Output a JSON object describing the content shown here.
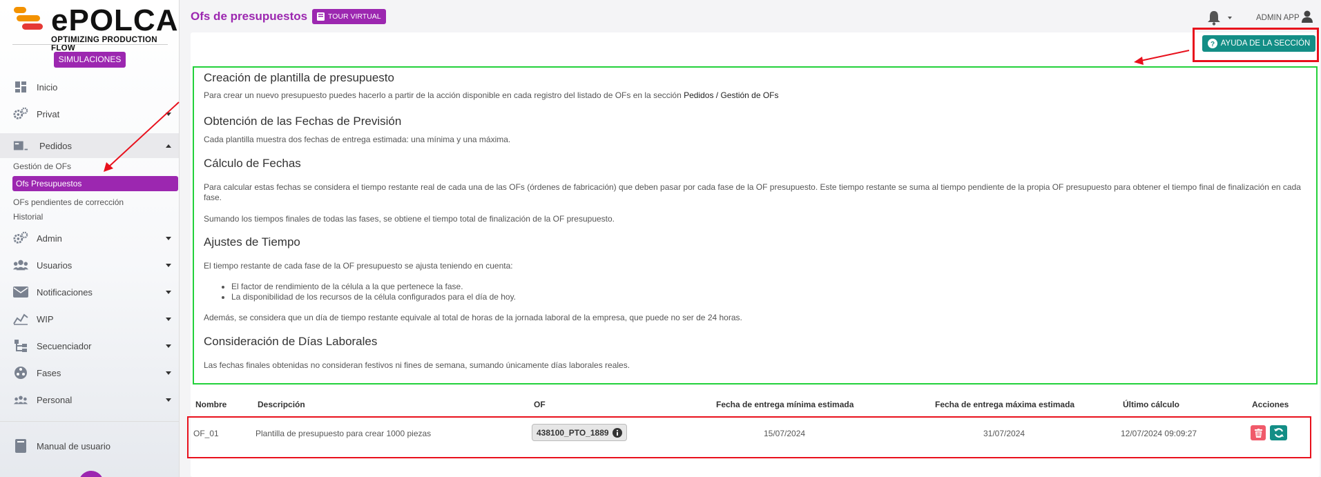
{
  "brand": {
    "name": "ePOLCA",
    "tagline": "OPTIMIZING PRODUCTION FLOW",
    "colors": {
      "orange": "#f39200",
      "red": "#e53935",
      "purple": "#9c27b0",
      "teal": "#138e86"
    }
  },
  "sidebar": {
    "simulaciones": "SIMULACIONES",
    "items": [
      {
        "label": "Inicio",
        "icon": "dashboard-icon"
      },
      {
        "label": "Privat",
        "icon": "cogs-icon"
      },
      {
        "label": "Pedidos",
        "icon": "orders-icon"
      },
      {
        "label": "Admin",
        "icon": "cogs-icon"
      },
      {
        "label": "Usuarios",
        "icon": "users-icon"
      },
      {
        "label": "Notificaciones",
        "icon": "envelope-icon"
      },
      {
        "label": "WIP",
        "icon": "chart-icon"
      },
      {
        "label": "Secuenciador",
        "icon": "sitemap-icon"
      },
      {
        "label": "Fases",
        "icon": "fases-icon"
      },
      {
        "label": "Personal",
        "icon": "personal-icon"
      }
    ],
    "pedidos_sub": [
      "Gestión de OFs",
      "Ofs Presupuestos",
      "OFs pendientes de corrección",
      "Historial"
    ],
    "manual": "Manual de usuario"
  },
  "header": {
    "title": "Ofs de presupuestos",
    "tour": "TOUR VIRTUAL",
    "user": "ADMIN APP"
  },
  "help_button": "AYUDA DE LA SECCIÓN",
  "help": {
    "h1": "Creación de plantilla de presupuesto",
    "p1": "Para crear un nuevo presupuesto puedes hacerlo a partir de la acción disponible en cada registro del listado de OFs en la sección",
    "p1_link": "Pedidos / Gestión de OFs",
    "h2": "Obtención de las Fechas de Previsión",
    "p2": "Cada plantilla muestra dos fechas de entrega estimada: una mínima y una máxima.",
    "h3": "Cálculo de Fechas",
    "p3": "Para calcular estas fechas se considera el tiempo restante real de cada una de las OFs (órdenes de fabricación) que deben pasar por cada fase de la OF presupuesto. Este tiempo restante se suma al tiempo pendiente de la propia OF presupuesto para obtener el tiempo final de finalización en cada fase.",
    "p4": "Sumando los tiempos finales de todas las fases, se obtiene el tiempo total de finalización de la OF presupuesto.",
    "h4": "Ajustes de Tiempo",
    "p5": "El tiempo restante de cada fase de la OF presupuesto se ajusta teniendo en cuenta:",
    "li1": "El factor de rendimiento de la célula a la que pertenece la fase.",
    "li2": "La disponibilidad de los recursos de la célula configurados para el día de hoy.",
    "p6": "Además, se considera que un día de tiempo restante equivale al total de horas de la jornada laboral de la empresa, que puede no ser de 24 horas.",
    "h5": "Consideración de Días Laborales",
    "p7": "Las fechas finales obtenidas no consideran festivos ni fines de semana, sumando únicamente días laborales reales."
  },
  "table": {
    "headers": [
      "Nombre",
      "Descripción",
      "OF",
      "Fecha de entrega mínima estimada",
      "Fecha de entrega máxima estimada",
      "Último cálculo",
      "Acciones"
    ],
    "rows": [
      {
        "nombre": "OF_01",
        "descripcion": "Plantilla de presupuesto para crear 1000 piezas",
        "of": "438100_PTO_1889",
        "fecha_min": "15/07/2024",
        "fecha_max": "31/07/2024",
        "ultimo": "12/07/2024 09:09:27"
      }
    ]
  }
}
